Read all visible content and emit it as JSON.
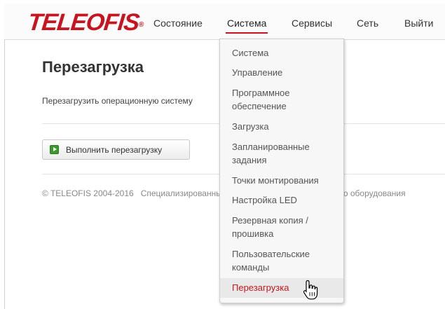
{
  "header": {
    "logo": "TELEOFIS",
    "logo_mark": "®",
    "nav": [
      {
        "label": "Состояние"
      },
      {
        "label": "Система"
      },
      {
        "label": "Сервисы"
      },
      {
        "label": "Сеть"
      },
      {
        "label": "Выйти"
      }
    ]
  },
  "main": {
    "title": "Перезагрузка",
    "description": "Перезагрузить операционную систему",
    "button_label": "Выполнить перезагрузку",
    "footer_left": "© TELEOFIS 2004-2016",
    "footer_right": "Специализированный производитель беспроводного оборудования"
  },
  "dropdown": {
    "items": [
      {
        "label": "Система"
      },
      {
        "label": "Управление"
      },
      {
        "label": "Программное",
        "label2": "обеспечение"
      },
      {
        "label": "Загрузка"
      },
      {
        "label": "Запланированные",
        "label2": "задания"
      },
      {
        "label": "Точки монтирования"
      },
      {
        "label": "Настройка LED"
      },
      {
        "label": "Резервная копия /",
        "label2": "прошивка"
      },
      {
        "label": "Пользовательские",
        "label2": "команды"
      },
      {
        "label": "Перезагрузка"
      }
    ]
  },
  "colors": {
    "brand": "#c7141e",
    "accent_button_icon": "#3c9a2c"
  },
  "icons": {
    "button": "play-icon",
    "cursor": "hand-pointer-icon"
  }
}
